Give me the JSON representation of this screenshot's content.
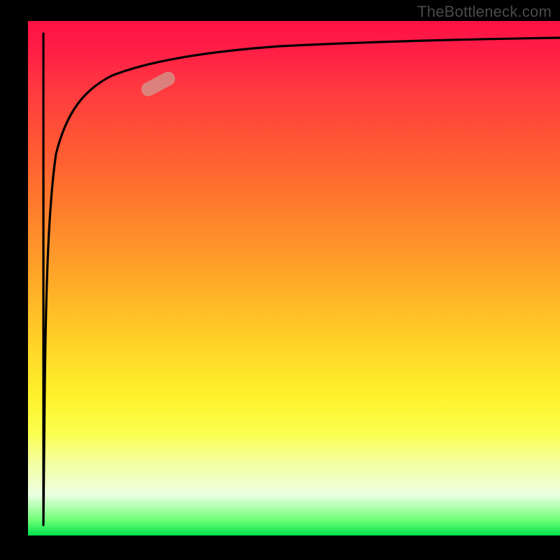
{
  "watermark": "TheBottleneck.com",
  "chart_data": {
    "type": "line",
    "title": "",
    "xlabel": "",
    "ylabel": "",
    "xlim": [
      0,
      100
    ],
    "ylim": [
      0,
      100
    ],
    "gradient_stops": [
      {
        "pos": 0,
        "color": "#ff1144"
      },
      {
        "pos": 25,
        "color": "#ff5a32"
      },
      {
        "pos": 52,
        "color": "#ffae28"
      },
      {
        "pos": 73,
        "color": "#fff22c"
      },
      {
        "pos": 92,
        "color": "#ecffe2"
      },
      {
        "pos": 100,
        "color": "#00e24c"
      }
    ],
    "series": [
      {
        "name": "bottleneck-curve",
        "x": [
          3,
          3.2,
          3.5,
          4,
          5,
          6,
          8,
          10,
          14,
          20,
          30,
          45,
          65,
          85,
          100
        ],
        "y": [
          2,
          40,
          60,
          74,
          82,
          86,
          89,
          90.5,
          92,
          93,
          94,
          95,
          95.7,
          96,
          96.2
        ]
      }
    ],
    "marker": {
      "x_pct": 25,
      "y_pct": 88,
      "angle_deg": -28
    }
  }
}
